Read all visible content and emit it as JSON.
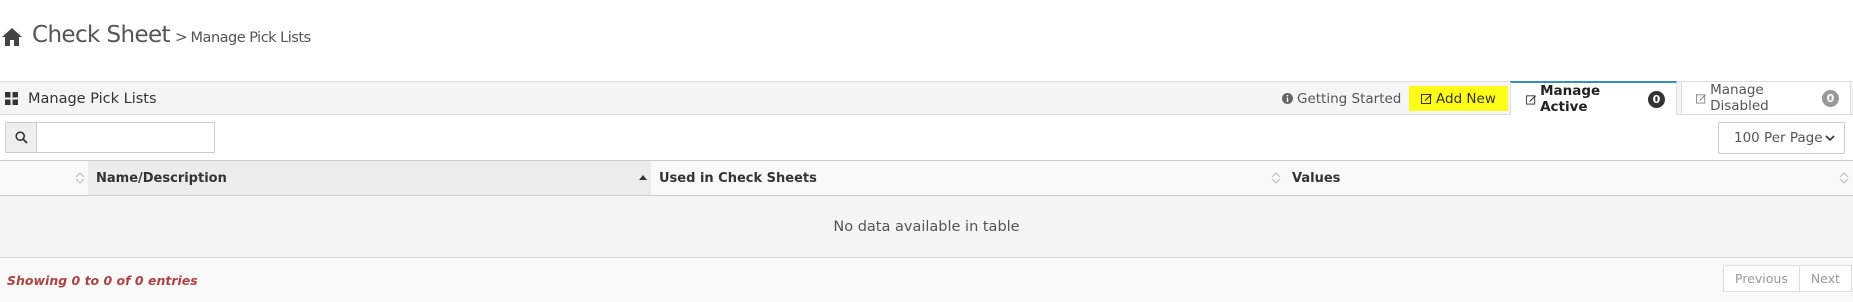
{
  "header": {
    "title": "Check Sheet",
    "separator": ">",
    "subtitle": "Manage Pick Lists"
  },
  "panel": {
    "title": "Manage Pick Lists",
    "tabs": [
      {
        "label": "Getting Started",
        "icon": "info-circle-icon"
      },
      {
        "label": "Add New",
        "icon": "edit-icon",
        "highlight": "#ffff1a"
      },
      {
        "label": "Manage Active",
        "icon": "edit-icon",
        "count": "0",
        "active": true
      },
      {
        "label": "Manage Disabled",
        "icon": "edit-icon",
        "count": "0"
      }
    ]
  },
  "controls": {
    "search_value": "",
    "per_page": "100 Per Page"
  },
  "table": {
    "columns": [
      "",
      "Name/Description",
      "Used in Check Sheets",
      "Values"
    ],
    "empty_message": "No data available in table",
    "info": "Showing 0 to 0 of 0 entries"
  },
  "pagination": {
    "previous": "Previous",
    "next": "Next"
  },
  "colors": {
    "accent": "#3b8fb0",
    "info_text": "#a94442",
    "highlight": "#ffff1a"
  }
}
